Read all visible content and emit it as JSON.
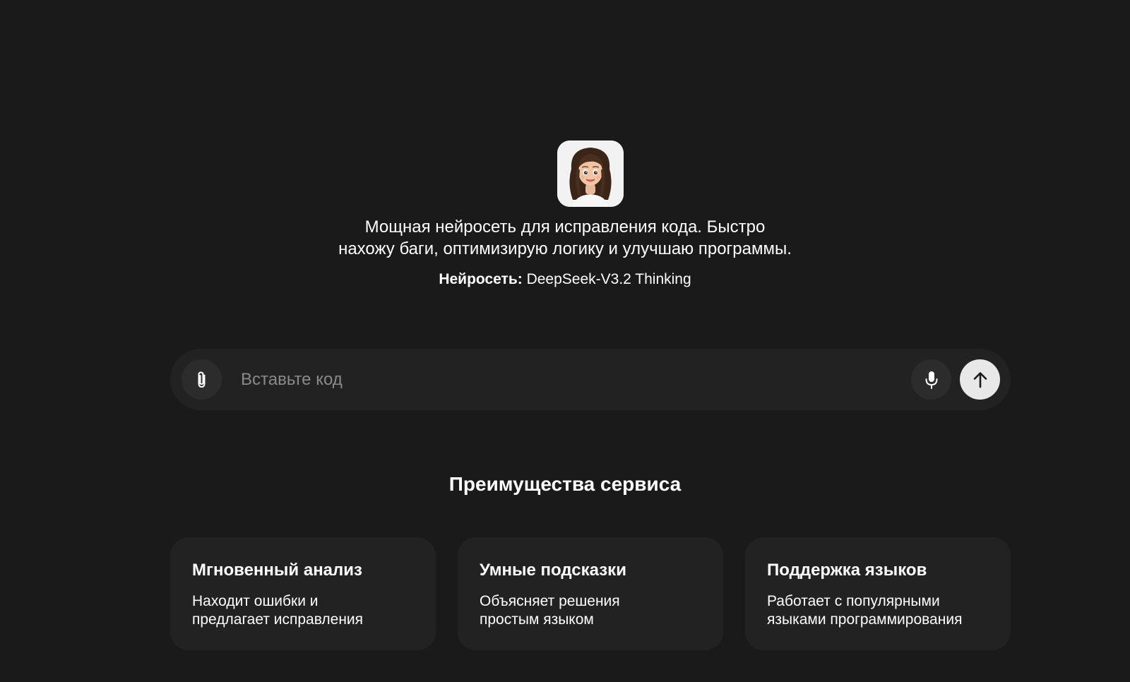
{
  "hero": {
    "avatar_icon": "assistant-avatar",
    "description_line1": "Мощная нейросеть для исправления кода. Быстро",
    "description_line2": "нахожу баги, оптимизирую логику и улучшаю программы.",
    "model_label": "Нейросеть:",
    "model_name": "DeepSeek-V3.2 Thinking"
  },
  "input_bar": {
    "placeholder": "Вставьте код",
    "value": "",
    "attach_icon": "paperclip-icon",
    "mic_icon": "microphone-icon",
    "send_icon": "arrow-up-icon"
  },
  "benefits": {
    "title": "Преимущества сервиса",
    "cards": [
      {
        "title": "Мгновенный анализ",
        "text_line1": "Находит ошибки и",
        "text_line2": "предлагает исправления"
      },
      {
        "title": "Умные подсказки",
        "text_line1": "Объясняет решения",
        "text_line2": "простым языком"
      },
      {
        "title": "Поддержка языков",
        "text_line1": "Работает с популярными",
        "text_line2": "языками программирования"
      }
    ]
  },
  "colors": {
    "background": "#1a1a1a",
    "surface": "#222222",
    "button_dark": "#2c2c2c",
    "send_button": "#e8e8e8",
    "placeholder": "#8a8a8a",
    "text": "#ffffff"
  }
}
